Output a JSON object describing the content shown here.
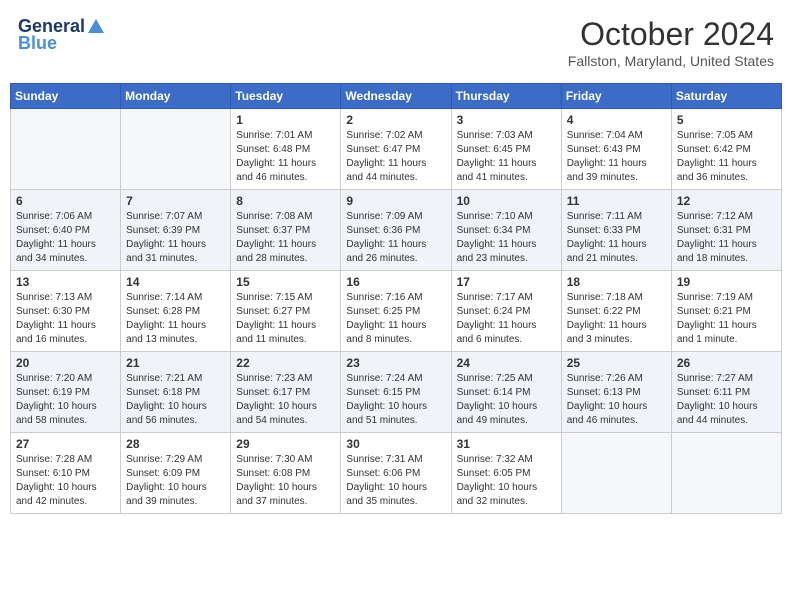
{
  "header": {
    "logo_general": "General",
    "logo_blue": "Blue",
    "month_year": "October 2024",
    "location": "Fallston, Maryland, United States"
  },
  "days_of_week": [
    "Sunday",
    "Monday",
    "Tuesday",
    "Wednesday",
    "Thursday",
    "Friday",
    "Saturday"
  ],
  "weeks": [
    [
      {
        "day": "",
        "content": ""
      },
      {
        "day": "",
        "content": ""
      },
      {
        "day": "1",
        "content": "Sunrise: 7:01 AM\nSunset: 6:48 PM\nDaylight: 11 hours and 46 minutes."
      },
      {
        "day": "2",
        "content": "Sunrise: 7:02 AM\nSunset: 6:47 PM\nDaylight: 11 hours and 44 minutes."
      },
      {
        "day": "3",
        "content": "Sunrise: 7:03 AM\nSunset: 6:45 PM\nDaylight: 11 hours and 41 minutes."
      },
      {
        "day": "4",
        "content": "Sunrise: 7:04 AM\nSunset: 6:43 PM\nDaylight: 11 hours and 39 minutes."
      },
      {
        "day": "5",
        "content": "Sunrise: 7:05 AM\nSunset: 6:42 PM\nDaylight: 11 hours and 36 minutes."
      }
    ],
    [
      {
        "day": "6",
        "content": "Sunrise: 7:06 AM\nSunset: 6:40 PM\nDaylight: 11 hours and 34 minutes."
      },
      {
        "day": "7",
        "content": "Sunrise: 7:07 AM\nSunset: 6:39 PM\nDaylight: 11 hours and 31 minutes."
      },
      {
        "day": "8",
        "content": "Sunrise: 7:08 AM\nSunset: 6:37 PM\nDaylight: 11 hours and 28 minutes."
      },
      {
        "day": "9",
        "content": "Sunrise: 7:09 AM\nSunset: 6:36 PM\nDaylight: 11 hours and 26 minutes."
      },
      {
        "day": "10",
        "content": "Sunrise: 7:10 AM\nSunset: 6:34 PM\nDaylight: 11 hours and 23 minutes."
      },
      {
        "day": "11",
        "content": "Sunrise: 7:11 AM\nSunset: 6:33 PM\nDaylight: 11 hours and 21 minutes."
      },
      {
        "day": "12",
        "content": "Sunrise: 7:12 AM\nSunset: 6:31 PM\nDaylight: 11 hours and 18 minutes."
      }
    ],
    [
      {
        "day": "13",
        "content": "Sunrise: 7:13 AM\nSunset: 6:30 PM\nDaylight: 11 hours and 16 minutes."
      },
      {
        "day": "14",
        "content": "Sunrise: 7:14 AM\nSunset: 6:28 PM\nDaylight: 11 hours and 13 minutes."
      },
      {
        "day": "15",
        "content": "Sunrise: 7:15 AM\nSunset: 6:27 PM\nDaylight: 11 hours and 11 minutes."
      },
      {
        "day": "16",
        "content": "Sunrise: 7:16 AM\nSunset: 6:25 PM\nDaylight: 11 hours and 8 minutes."
      },
      {
        "day": "17",
        "content": "Sunrise: 7:17 AM\nSunset: 6:24 PM\nDaylight: 11 hours and 6 minutes."
      },
      {
        "day": "18",
        "content": "Sunrise: 7:18 AM\nSunset: 6:22 PM\nDaylight: 11 hours and 3 minutes."
      },
      {
        "day": "19",
        "content": "Sunrise: 7:19 AM\nSunset: 6:21 PM\nDaylight: 11 hours and 1 minute."
      }
    ],
    [
      {
        "day": "20",
        "content": "Sunrise: 7:20 AM\nSunset: 6:19 PM\nDaylight: 10 hours and 58 minutes."
      },
      {
        "day": "21",
        "content": "Sunrise: 7:21 AM\nSunset: 6:18 PM\nDaylight: 10 hours and 56 minutes."
      },
      {
        "day": "22",
        "content": "Sunrise: 7:23 AM\nSunset: 6:17 PM\nDaylight: 10 hours and 54 minutes."
      },
      {
        "day": "23",
        "content": "Sunrise: 7:24 AM\nSunset: 6:15 PM\nDaylight: 10 hours and 51 minutes."
      },
      {
        "day": "24",
        "content": "Sunrise: 7:25 AM\nSunset: 6:14 PM\nDaylight: 10 hours and 49 minutes."
      },
      {
        "day": "25",
        "content": "Sunrise: 7:26 AM\nSunset: 6:13 PM\nDaylight: 10 hours and 46 minutes."
      },
      {
        "day": "26",
        "content": "Sunrise: 7:27 AM\nSunset: 6:11 PM\nDaylight: 10 hours and 44 minutes."
      }
    ],
    [
      {
        "day": "27",
        "content": "Sunrise: 7:28 AM\nSunset: 6:10 PM\nDaylight: 10 hours and 42 minutes."
      },
      {
        "day": "28",
        "content": "Sunrise: 7:29 AM\nSunset: 6:09 PM\nDaylight: 10 hours and 39 minutes."
      },
      {
        "day": "29",
        "content": "Sunrise: 7:30 AM\nSunset: 6:08 PM\nDaylight: 10 hours and 37 minutes."
      },
      {
        "day": "30",
        "content": "Sunrise: 7:31 AM\nSunset: 6:06 PM\nDaylight: 10 hours and 35 minutes."
      },
      {
        "day": "31",
        "content": "Sunrise: 7:32 AM\nSunset: 6:05 PM\nDaylight: 10 hours and 32 minutes."
      },
      {
        "day": "",
        "content": ""
      },
      {
        "day": "",
        "content": ""
      }
    ]
  ]
}
